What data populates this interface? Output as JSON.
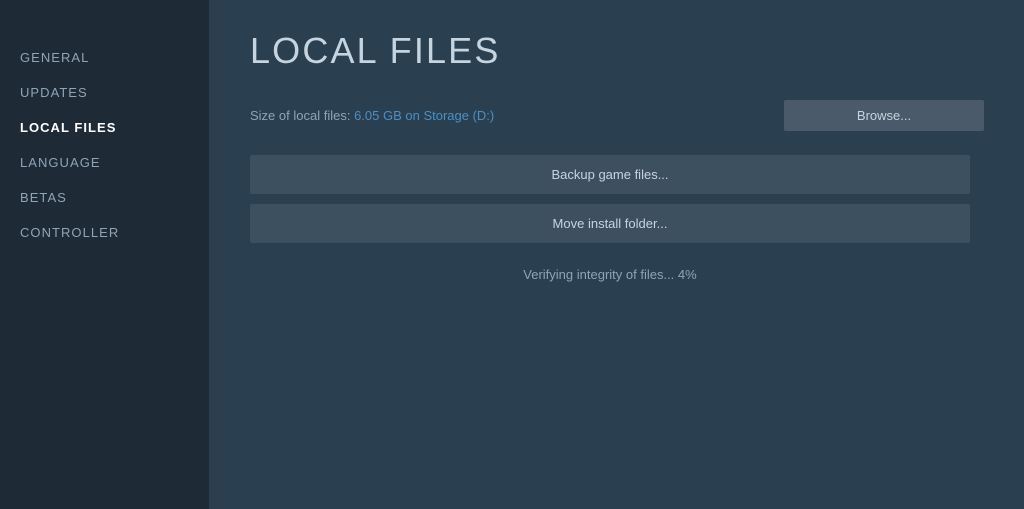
{
  "sidebar": {
    "items": [
      {
        "id": "general",
        "label": "GENERAL",
        "active": false
      },
      {
        "id": "updates",
        "label": "UPDATES",
        "active": false
      },
      {
        "id": "local-files",
        "label": "LOCAL FILES",
        "active": true
      },
      {
        "id": "language",
        "label": "LANGUAGE",
        "active": false
      },
      {
        "id": "betas",
        "label": "BETAS",
        "active": false
      },
      {
        "id": "controller",
        "label": "CONTROLLER",
        "active": false
      }
    ]
  },
  "main": {
    "page_title": "LOCAL FILES",
    "file_size_label": "Size of local files:",
    "file_size_value": "6.05 GB on Storage (D:)",
    "browse_button_label": "Browse...",
    "backup_button_label": "Backup game files...",
    "move_button_label": "Move install folder...",
    "verify_status": "Verifying integrity of files... 4%"
  },
  "colors": {
    "accent_blue": "#4b8fc4",
    "sidebar_bg": "#1e2a35",
    "main_bg": "#2a3f4f",
    "button_bg": "#3d5060",
    "text_light": "#c6d4df",
    "text_muted": "#8fa4b5"
  }
}
